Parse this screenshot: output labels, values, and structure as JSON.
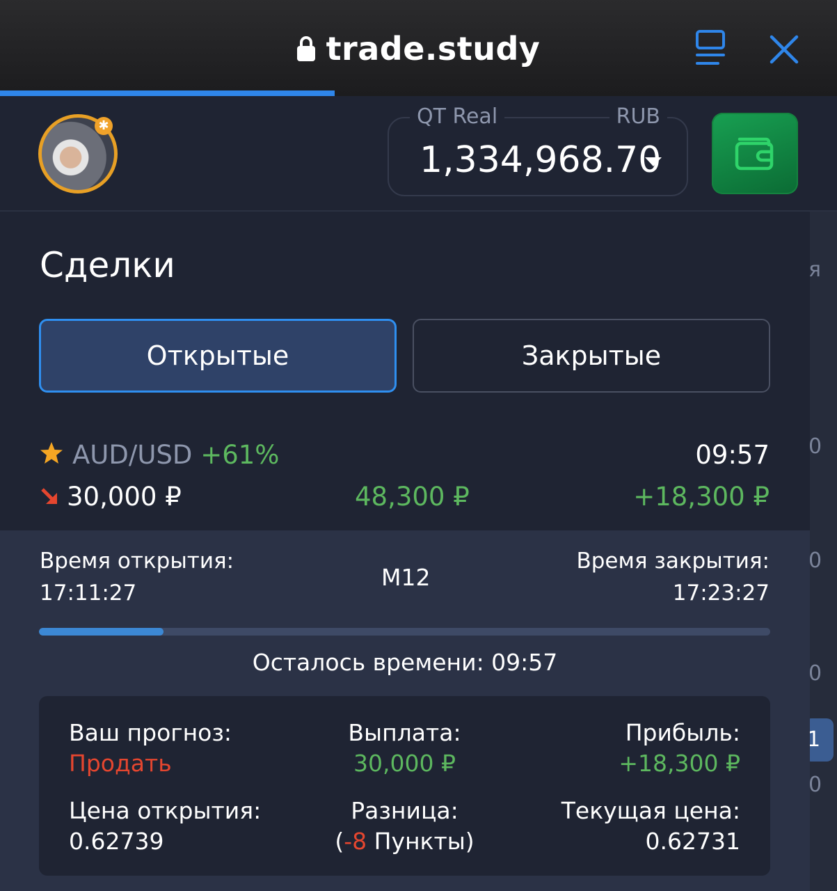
{
  "browser": {
    "url": "trade.study",
    "load_progress": 0.4
  },
  "header": {
    "account_type": "QT Real",
    "currency": "RUB",
    "balance": "1,334,968.70",
    "avatar_badge": "✱"
  },
  "page": {
    "title": "Сделки",
    "tabs": {
      "open": "Открытые",
      "closed": "Закрытые"
    }
  },
  "trade": {
    "pair": "AUD/USD",
    "pair_percent": "+61%",
    "timer": "09:57",
    "stake": "30,000 ₽",
    "payout": "48,300 ₽",
    "profit": "+18,300 ₽",
    "direction": "down"
  },
  "details": {
    "open_time_label": "Время открытия:",
    "open_time": "17:11:27",
    "timeframe": "M12",
    "close_time_label": "Время закрытия:",
    "close_time": "17:23:27",
    "elapsed_fraction": 0.17,
    "remaining_label": "Осталось времени: 09:57",
    "forecast_label": "Ваш прогноз:",
    "forecast_value": "Продать",
    "payout_label": "Выплата:",
    "payout_value": "30,000 ₽",
    "profit_label": "Прибыль:",
    "profit_value": "+18,300 ₽",
    "open_price_label": "Цена открытия:",
    "open_price": "0.62739",
    "diff_label": "Разница:",
    "diff_open": "(",
    "diff_value": "-8",
    "diff_unit": " Пункты)",
    "current_price_label": "Текущая цена:",
    "current_price": "0.62731"
  },
  "right_strip": {
    "items": [
      "я",
      "0",
      "0",
      "0",
      "1",
      "0"
    ]
  },
  "colors": {
    "accent": "#2f8ff0",
    "positive": "#5db85f",
    "negative": "#e5462f",
    "background": "#1f2433"
  }
}
